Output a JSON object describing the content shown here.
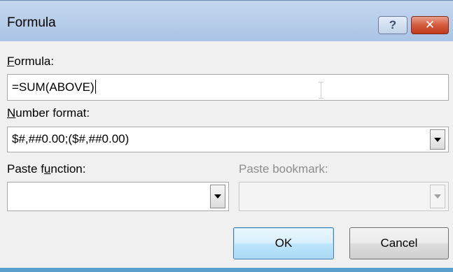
{
  "window": {
    "title": "Formula",
    "help_glyph": "?",
    "close_glyph": "✕"
  },
  "formula": {
    "label_accel": "F",
    "label_rest": "ormula:",
    "value": "=SUM(ABOVE)"
  },
  "number_format": {
    "label_accel": "N",
    "label_rest": "umber format:",
    "value": "$#,##0.00;($#,##0.00)"
  },
  "paste_function": {
    "label_before": "Paste f",
    "label_accel": "u",
    "label_after": "nction:",
    "value": ""
  },
  "paste_bookmark": {
    "label": "Paste bookmark:",
    "value": "",
    "enabled": false
  },
  "buttons": {
    "ok": "OK",
    "cancel": "Cancel"
  }
}
